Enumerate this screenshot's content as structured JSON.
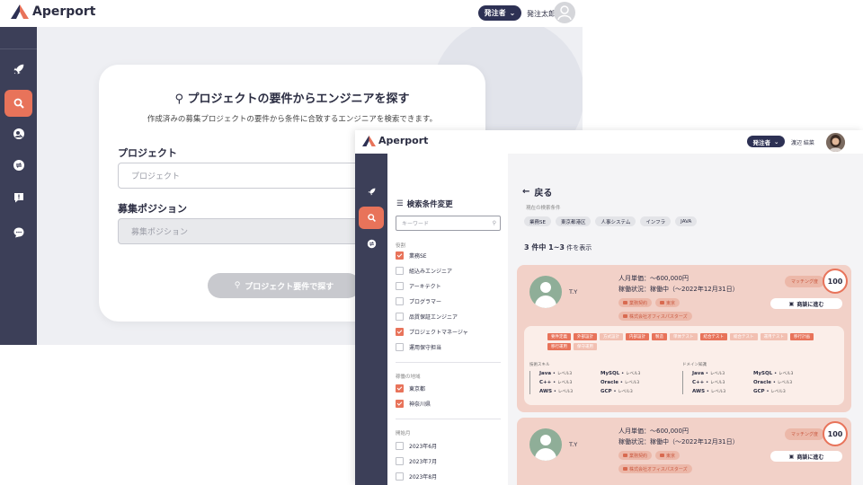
{
  "brand": "Aperport",
  "screen1": {
    "role_label": "発注者",
    "user_name": "発注太郎",
    "title": "プロジェクトの要件からエンジニアを探す",
    "subtitle": "作成済みの募集プロジェクトの要件から条件に合致するエンジニアを検索できます。",
    "project_label": "プロジェクト",
    "project_placeholder": "プロジェクト",
    "position_label": "募集ポジション",
    "position_placeholder": "募集ポジション",
    "search_button": "プロジェクト要件で探す"
  },
  "screen2": {
    "role_label": "発注者",
    "user_name": "渡辺 結菜",
    "filter": {
      "title": "検索条件変更",
      "keyword_placeholder": "キーワード",
      "role_label": "役割",
      "roles": [
        {
          "label": "業務SE",
          "checked": true
        },
        {
          "label": "組込みエンジニア",
          "checked": false
        },
        {
          "label": "アーキテクト",
          "checked": false
        },
        {
          "label": "プログラマー",
          "checked": false
        },
        {
          "label": "品質保証エンジニア",
          "checked": false
        },
        {
          "label": "プロジェクトマネージャ",
          "checked": true
        },
        {
          "label": "運用保守担当",
          "checked": false
        }
      ],
      "area_label": "稼働の地域",
      "areas": [
        {
          "label": "東京都",
          "checked": true
        },
        {
          "label": "神奈川県",
          "checked": true
        }
      ],
      "month_label": "開始月",
      "months": [
        {
          "label": "2023年6月",
          "checked": false
        },
        {
          "label": "2023年7月",
          "checked": false
        },
        {
          "label": "2023年8月",
          "checked": false
        }
      ]
    },
    "back_label": "戻る",
    "current_label": "現在の検索条件",
    "current_chips": [
      "業務SE",
      "東京都港区",
      "人事システム",
      "インフラ",
      "JAVA"
    ],
    "count_prefix": "3 件中 ",
    "count_range": "1~3",
    "count_suffix": " 件を表示",
    "results": [
      {
        "initials": "T.Y",
        "price": "人月単価：～600,000円",
        "status": "稼働状況：稼働中（～2022年12月31日）",
        "tag_contract": "業務契約",
        "tag_location": "東京",
        "company": "株式会社オフィスパスターズ",
        "match_label": "マッチング度",
        "score": "100",
        "talk_label": "商談に進む",
        "skills": [
          {
            "label": "要件定義",
            "pale": false
          },
          {
            "label": "外部設計",
            "pale": false
          },
          {
            "label": "方式設計",
            "pale": true
          },
          {
            "label": "内部設計",
            "pale": false
          },
          {
            "label": "製造",
            "pale": false
          },
          {
            "label": "単体テスト",
            "pale": true
          },
          {
            "label": "結合テスト",
            "pale": false
          },
          {
            "label": "総合テスト",
            "pale": true
          },
          {
            "label": "運用テスト",
            "pale": true
          },
          {
            "label": "移行計画",
            "pale": false
          },
          {
            "label": "移行運用",
            "pale": false
          },
          {
            "label": "保守運用",
            "pale": true
          }
        ],
        "tech_label": "技術スキル",
        "domain_label": "ドメイン知識",
        "level_text": "レベル3",
        "tech": [
          "Java",
          "MySQL",
          "C++",
          "Oracle",
          "AWS",
          "GCP"
        ],
        "domain": [
          "Java",
          "MySQL",
          "C++",
          "Oracle",
          "AWS",
          "GCP"
        ]
      },
      {
        "initials": "T.Y",
        "price": "人月単価：～600,000円",
        "status": "稼働状況：稼働中（～2022年12月31日）",
        "tag_contract": "業務契約",
        "tag_location": "東京",
        "company": "株式会社オフィスパスターズ",
        "match_label": "マッチング度",
        "score": "100",
        "talk_label": "商談に進む"
      }
    ]
  },
  "colors": {
    "accent": "#e8735a",
    "sidebar": "#3c3f58",
    "navy": "#2d3154",
    "card_bg": "#f2d1c8"
  }
}
